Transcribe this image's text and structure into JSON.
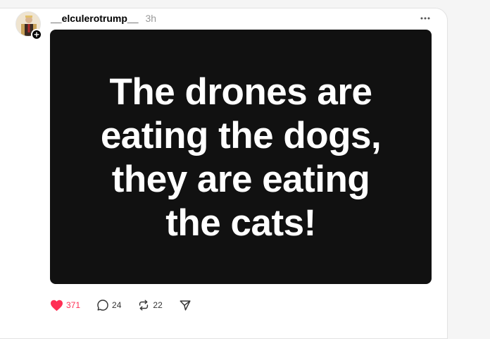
{
  "post": {
    "username": "__elculerotrump__",
    "timestamp": "3h",
    "avatar_icon": "user-avatar",
    "media_text": "The drones are\neating the dogs,\nthey are eating\nthe cats!",
    "actions": {
      "like_count": "371",
      "reply_count": "24",
      "repost_count": "22"
    },
    "colors": {
      "like": "#ff2e54",
      "media_bg": "#111111"
    }
  }
}
